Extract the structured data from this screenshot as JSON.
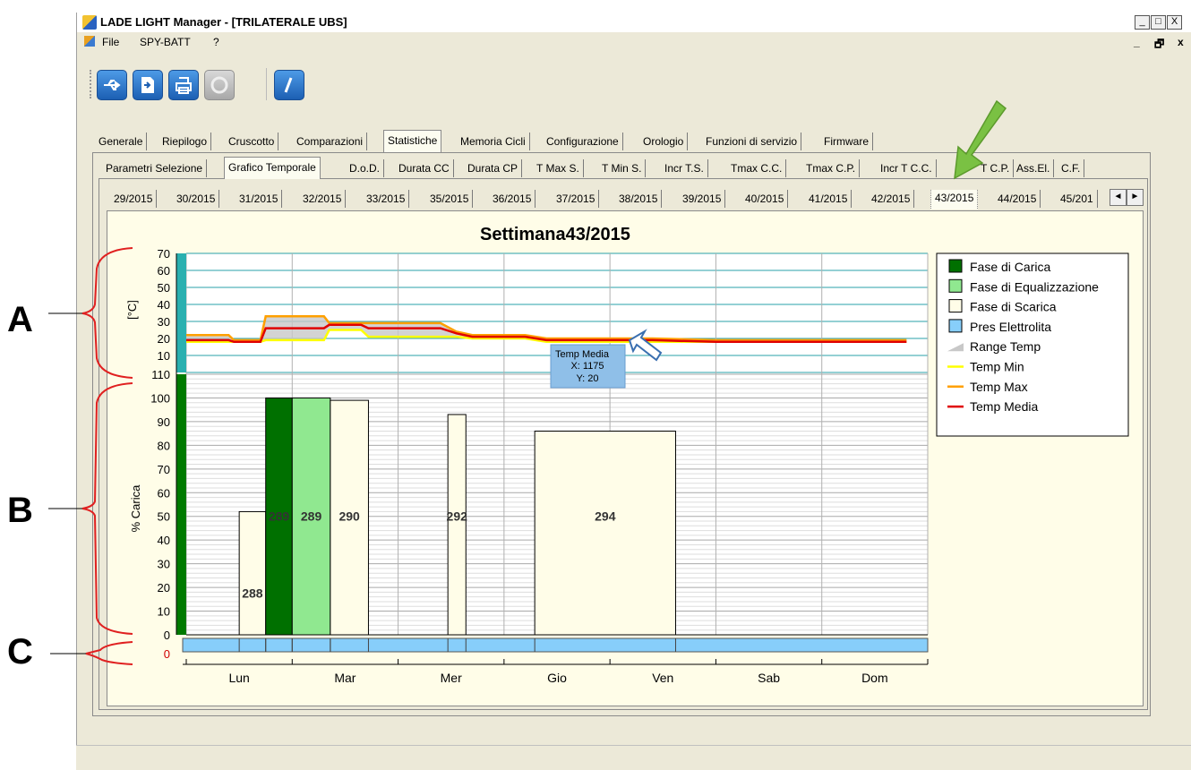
{
  "window": {
    "title": "LADE LIGHT Manager - [TRILATERALE UBS]",
    "min_glyph": "_",
    "max_glyph": "□",
    "close_glyph": "X",
    "mdi_min": "_",
    "mdi_restore": "🗗",
    "mdi_close": "x"
  },
  "menu": {
    "items": [
      "File",
      "SPY-BATT",
      "?"
    ]
  },
  "toolbar": {
    "buttons": [
      {
        "icon": "usb-icon",
        "enabled": true
      },
      {
        "icon": "open-file-icon",
        "enabled": true
      },
      {
        "icon": "print-icon",
        "enabled": true
      },
      {
        "icon": "record-icon",
        "enabled": false
      },
      {
        "icon": "close-x-icon",
        "enabled": true
      }
    ]
  },
  "main_tabs": [
    "Generale",
    "Riepilogo",
    "Cruscotto",
    "Comparazioni",
    "Statistiche",
    "Memoria Cicli",
    "Configurazione",
    "Orologio",
    "Funzioni di servizio",
    "Firmware"
  ],
  "main_tabs_selected": "Statistiche",
  "sub_tabs": [
    "Parametri Selezione",
    "Grafico Temporale",
    "D.o.D.",
    "Durata CC",
    "Durata CP",
    "T Max S.",
    "T Min S.",
    "Incr T.S.",
    "Tmax C.C.",
    "Tmax C.P.",
    "Incr T C.C.",
    "Incr T C.P.",
    "Ass.El.",
    "C.F."
  ],
  "sub_tabs_visible": [
    "Parametri Selezione",
    "Grafico Temporale",
    "D.o.D.",
    "Durata CC",
    "Durata CP",
    "T Max S.",
    "T Min S.",
    "Incr T.S.",
    "Tmax C.C.",
    "Tmax C.P.",
    "Incr T C.C.",
    "T C.P.",
    "Ass.El.",
    "C.F."
  ],
  "sub_tabs_selected": "Grafico Temporale",
  "week_tabs": [
    "29/2015",
    "30/2015",
    "31/2015",
    "32/2015",
    "33/2015",
    "35/2015",
    "36/2015",
    "37/2015",
    "38/2015",
    "39/2015",
    "40/2015",
    "41/2015",
    "42/2015",
    "43/2015",
    "44/2015",
    "45/201"
  ],
  "week_tabs_selected": "43/2015",
  "scroll": {
    "left": "◄",
    "right": "►"
  },
  "annotations": {
    "a": "A",
    "b": "B",
    "c": "C"
  },
  "colors": {
    "charge": "#007000",
    "equalize": "#90e890",
    "discharge": "#fffde8",
    "electrolyte": "#87cefa",
    "range": "#c8c8c8",
    "tmin": "#ffff00",
    "tmax": "#ffa000",
    "tmedia": "#e00000",
    "arrow": "#7ac143"
  },
  "chart_data": {
    "title": "Settimana43/2015",
    "temp_axis": {
      "label": "[°C]",
      "ticks": [
        10,
        20,
        30,
        40,
        50,
        60,
        70
      ],
      "ylim": [
        0,
        70
      ]
    },
    "charge_axis": {
      "label": "% Carica",
      "ticks": [
        0,
        10,
        20,
        30,
        40,
        50,
        60,
        70,
        80,
        90,
        100,
        110
      ],
      "ylim": [
        0,
        110
      ]
    },
    "electrolyte_axis": {
      "ticks": [
        "0"
      ]
    },
    "x_categories": [
      "Lun",
      "Mar",
      "Mer",
      "Gio",
      "Ven",
      "Sab",
      "Dom"
    ],
    "legend": [
      "Fase di Carica",
      "Fase di Equalizzazione",
      "Fase di Scarica",
      "Pres Elettrolita",
      "Range Temp",
      "Temp Min",
      "Temp Max",
      "Temp Media"
    ],
    "bars": [
      {
        "label": "288",
        "phase": "discharge",
        "value": 52,
        "day_start": 0.5,
        "day_end": 0.75
      },
      {
        "label": "289",
        "phase": "charge",
        "value": 100,
        "day_start": 0.75,
        "day_end": 1.0
      },
      {
        "label": "289",
        "phase": "equalize",
        "value": 100,
        "day_start": 1.0,
        "day_end": 1.36
      },
      {
        "label": "290",
        "phase": "discharge",
        "value": 99,
        "day_start": 1.36,
        "day_end": 1.72
      },
      {
        "label": "292",
        "phase": "discharge",
        "value": 93,
        "day_start": 2.47,
        "day_end": 2.64
      },
      {
        "label": "294",
        "phase": "discharge",
        "value": 86,
        "day_start": 3.29,
        "day_end": 4.62
      }
    ],
    "temperature": {
      "day": [
        0.0,
        0.4,
        0.45,
        0.7,
        0.75,
        1.3,
        1.35,
        1.65,
        1.72,
        2.2,
        2.4,
        2.55,
        2.7,
        3.2,
        3.4,
        4.0,
        4.4,
        5.0,
        6.0,
        6.8
      ],
      "media": [
        19,
        19,
        18,
        18,
        26,
        26,
        28,
        28,
        26,
        26,
        26,
        23,
        21,
        21,
        19,
        19,
        19,
        18,
        18,
        18
      ],
      "min": [
        18,
        18,
        18,
        18,
        19,
        19,
        25,
        25,
        21,
        21,
        21,
        21,
        20,
        20,
        18,
        18,
        18,
        18,
        18,
        18
      ],
      "max": [
        22,
        22,
        19,
        19,
        33,
        33,
        29,
        29,
        29,
        29,
        29,
        24,
        22,
        22,
        20,
        20,
        20,
        19,
        19,
        19
      ]
    },
    "tooltip": {
      "series": "Temp Media",
      "x": "X: 1175",
      "y": "Y: 20"
    }
  }
}
